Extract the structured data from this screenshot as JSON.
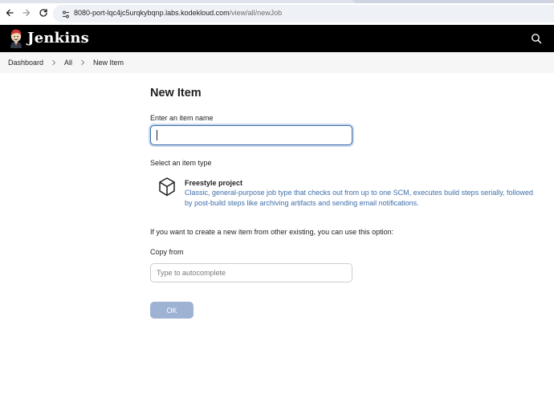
{
  "browser": {
    "url_host": "8080-port-lqc4jc5urqkybqnp.labs.kodekloud.com",
    "url_path": "/view/all/newJob"
  },
  "header": {
    "brand": "Jenkins",
    "colors": {
      "background": "#000000",
      "text": "#ffffff"
    }
  },
  "breadcrumb": {
    "items": [
      "Dashboard",
      "All",
      "New Item"
    ]
  },
  "main": {
    "title": "New Item",
    "name_label": "Enter an item name",
    "name_value": "",
    "type_label": "Select an item type",
    "item_types": [
      {
        "title": "Freestyle project",
        "description": "Classic, general-purpose job type that checks out from up to one SCM, executes build steps serially, followed by post-build steps like archiving artifacts and sending email notifications.",
        "icon": "freestyle-project-icon"
      }
    ],
    "copy_hint": "If you want to create a new item from other existing, you can use this option:",
    "copy_label": "Copy from",
    "copy_placeholder": "Type to autocomplete",
    "ok_label": "OK"
  },
  "colors": {
    "accent": "#3e6fa8",
    "ok_button_disabled": "#9eb2d4",
    "breadcrumb_bg": "#f6f6f7"
  }
}
